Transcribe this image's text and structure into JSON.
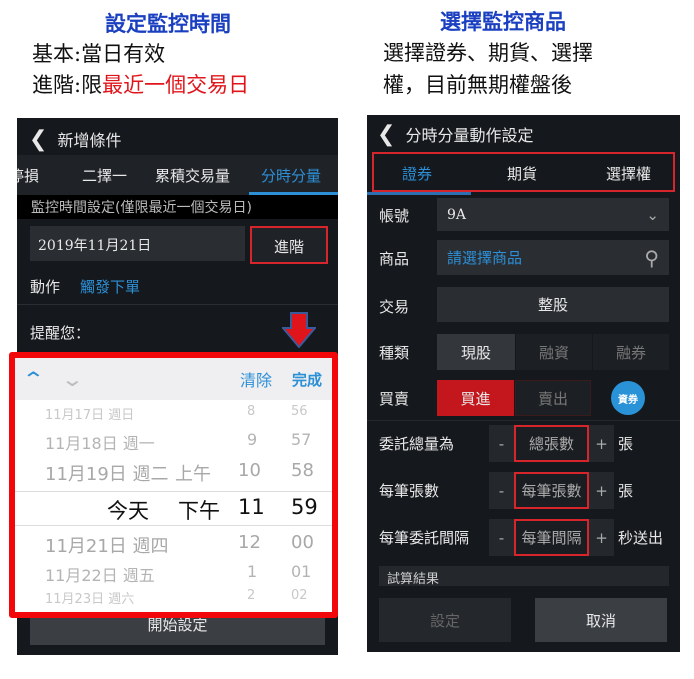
{
  "left": {
    "title": "設定監控時間",
    "basic": "基本:當日有效",
    "advanced_prefix": "進階:限",
    "advanced_highlight": "最近一個交易日",
    "header": {
      "title": "新增條件"
    },
    "tabs": [
      "停損",
      "二擇一",
      "累積交易量",
      "分時分量"
    ],
    "active_tab": 3,
    "monitor_label": "監控時間設定(僅限最近一個交易日)",
    "date_value": "2019年11月21日",
    "advanced_button": "進階",
    "action_label": "動作",
    "action_value": "觸發下單",
    "remind_label": "提醒您：",
    "picker": {
      "clear": "清除",
      "done": "完成",
      "rows": [
        {
          "date": "11月17日 週日",
          "ampm": "",
          "hour": "8",
          "min": "56"
        },
        {
          "date": "11月18日 週一",
          "ampm": "",
          "hour": "9",
          "min": "57"
        },
        {
          "date": "11月19日 週二",
          "ampm": "上午",
          "hour": "10",
          "min": "58"
        },
        {
          "date": "今天",
          "ampm": "下午",
          "hour": "11",
          "min": "59"
        },
        {
          "date": "11月21日 週四",
          "ampm": "",
          "hour": "12",
          "min": "00"
        },
        {
          "date": "11月22日 週五",
          "ampm": "",
          "hour": "1",
          "min": "01"
        },
        {
          "date": "11月23日 週六",
          "ampm": "",
          "hour": "2",
          "min": "02"
        }
      ]
    },
    "start_button": "開始設定"
  },
  "right": {
    "title": "選擇監控商品",
    "desc1": "選擇證券、期貨、選擇",
    "desc2": "權，目前無期權盤後",
    "header": {
      "title": "分時分量動作設定"
    },
    "tabs": [
      "證券",
      "期貨",
      "選擇權"
    ],
    "active_tab": 0,
    "account_label": "帳號",
    "account_value": "9A",
    "product_label": "商品",
    "product_placeholder": "請選擇商品",
    "trade_label": "交易",
    "trade_value": "整股",
    "type_label": "種類",
    "types": [
      "現股",
      "融資",
      "融券"
    ],
    "side_label": "買賣",
    "buy": "買進",
    "sell": "賣出",
    "badge": "資券",
    "total_label": "委託總量為",
    "total_placeholder": "總張數",
    "unit": "張",
    "per_label": "每筆張數",
    "per_placeholder": "每筆張數",
    "interval_label": "每筆委託間隔",
    "interval_placeholder": "每筆間隔",
    "interval_unit": "秒送出",
    "minus": "-",
    "plus": "+",
    "result_label": "試算結果",
    "set_button": "設定",
    "cancel_button": "取消"
  },
  "colors": {
    "accent": "#2d8fd6",
    "highlight": "#e0151b",
    "buy": "#c4171d"
  }
}
